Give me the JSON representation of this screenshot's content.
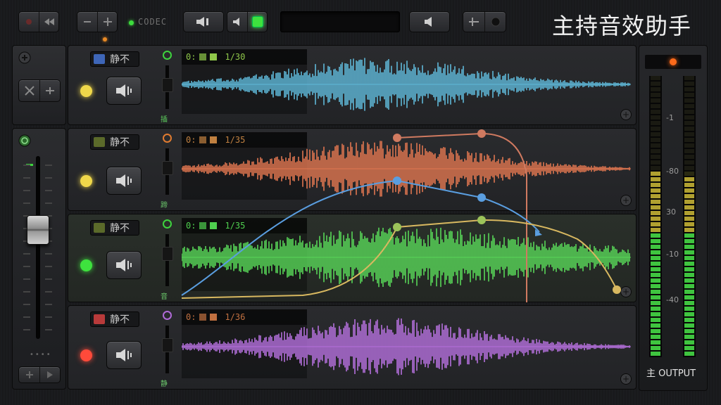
{
  "app": {
    "title": "主持音效助手"
  },
  "toolbar": {
    "codec_label": "CODEC",
    "accent_green": "#3ee23e",
    "accent_orange": "#e98a25"
  },
  "tracks": [
    {
      "mute_label": "静不",
      "mute_color": "#3e66b8",
      "led_color": "#f0d84a",
      "ring_color": "#3ed43e",
      "clip_time": "0:",
      "clip_length": "1/30",
      "channel_label": "插",
      "wave_color": "#5fb8d8",
      "info_color": "#8fc74a",
      "label_color": "#5fd45f"
    },
    {
      "mute_label": "静不",
      "mute_color": "#5b6a2a",
      "led_color": "#f0d84a",
      "ring_color": "#e07b30",
      "clip_time": "0:",
      "clip_length": "1/35",
      "channel_label": "蹄",
      "wave_color": "#e07650",
      "info_color": "#c08040",
      "label_color": "#6ac46a"
    },
    {
      "mute_label": "静不",
      "mute_color": "#5b6a2a",
      "led_color": "#3ee23e",
      "ring_color": "#3ed43e",
      "clip_time": "0:",
      "clip_length": "1/35",
      "channel_label": "音",
      "wave_color": "#58d658",
      "info_color": "#4fcf4f",
      "label_color": "#6ac46a"
    },
    {
      "mute_label": "静不",
      "mute_color": "#b83a3a",
      "led_color": "#ff4a3a",
      "ring_color": "#b06ad8",
      "clip_time": "0:",
      "clip_length": "1/36",
      "channel_label": "静",
      "wave_color": "#b470dc",
      "info_color": "#c07040",
      "label_color": "#6ac46a"
    }
  ],
  "meter": {
    "scale": [
      "-1",
      "-80",
      "30",
      "-10",
      "-40"
    ],
    "output_label": "主 OUTPUT",
    "peak_color": "#ff6a1a"
  },
  "icons": {
    "speaker": "speaker-icon",
    "plus": "plus-icon",
    "power": "power-icon"
  }
}
